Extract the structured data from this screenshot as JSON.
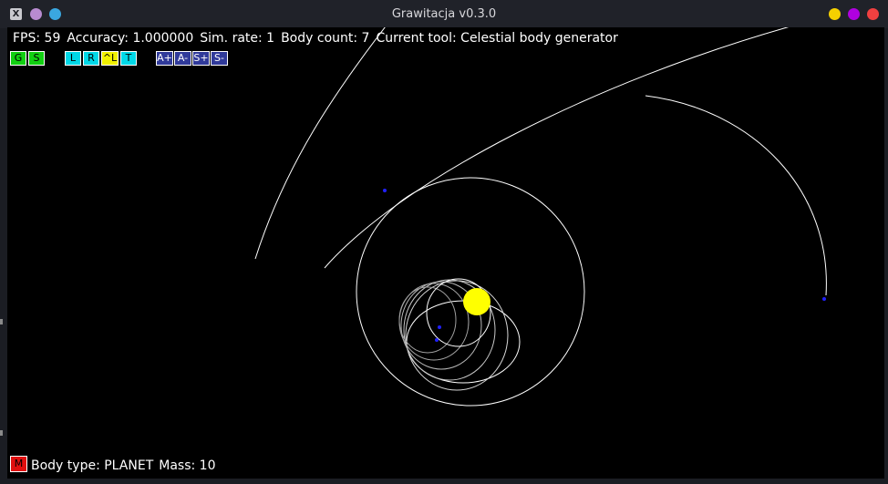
{
  "window": {
    "title": "Grawitacja v0.3.0",
    "app_icon": "X",
    "left_dots": [
      "#b88bd0",
      "#3aa7e0"
    ],
    "right_dots": [
      "#f5d000",
      "#b000e0",
      "#f04040"
    ]
  },
  "status": {
    "fps": "FPS: 59",
    "accuracy": "Accuracy: 1.000000",
    "sim_rate": "Sim. rate: 1",
    "body_count": "Body count: 7",
    "current_tool": "Current tool: Celestial body generator"
  },
  "toolbar": {
    "buttons": [
      {
        "label": "G",
        "color": "#12d012",
        "group": "generator"
      },
      {
        "label": "S",
        "color": "#12d012",
        "group": "generator"
      },
      {
        "label": "L",
        "color": "#00d8e8",
        "group": "view"
      },
      {
        "label": "R",
        "color": "#00d8e8",
        "group": "view"
      },
      {
        "label": "^L",
        "color": "#f0f000",
        "group": "view"
      },
      {
        "label": "T",
        "color": "#00d8e8",
        "group": "view"
      },
      {
        "label": "A+",
        "color": "#303a9a",
        "group": "sim"
      },
      {
        "label": "A-",
        "color": "#303a9a",
        "group": "sim"
      },
      {
        "label": "S+",
        "color": "#303a9a",
        "group": "sim"
      },
      {
        "label": "S-",
        "color": "#303a9a",
        "group": "sim"
      }
    ]
  },
  "body_panel": {
    "mass_button": "M",
    "mass_button_color": "#e01010",
    "body_type": "Body type: PLANET",
    "mass": "Mass: 10"
  },
  "scene": {
    "sun_color": "#ffff00",
    "orbit_color": "#ffffff",
    "planet_color": "#2020ff"
  }
}
